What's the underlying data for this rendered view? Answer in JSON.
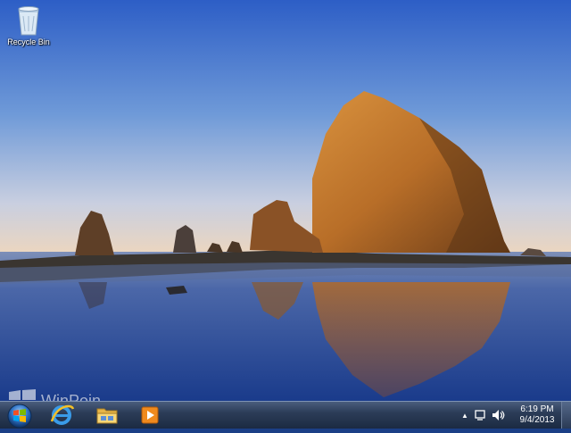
{
  "desktop": {
    "icons": [
      {
        "label": "Recycle Bin",
        "icon": "recycle-bin-icon"
      }
    ]
  },
  "watermark": {
    "text": "WinPoin"
  },
  "taskbar": {
    "start": {
      "icon": "windows-orb-icon"
    },
    "pinned": [
      {
        "icon": "internet-explorer-icon"
      },
      {
        "icon": "windows-explorer-icon"
      },
      {
        "icon": "windows-media-player-icon"
      }
    ],
    "tray": {
      "icons": [
        "show-hidden-icons-arrow",
        "action-center-flag-icon",
        "volume-icon"
      ],
      "time": "6:19 PM",
      "date": "9/4/2013"
    }
  },
  "colors": {
    "sky_top": "#2e5fc4",
    "sky_horizon": "#e9d7c4",
    "water": "#1d3f8a",
    "rock": "#c07a2e",
    "taskbar": "#2c3d58"
  }
}
